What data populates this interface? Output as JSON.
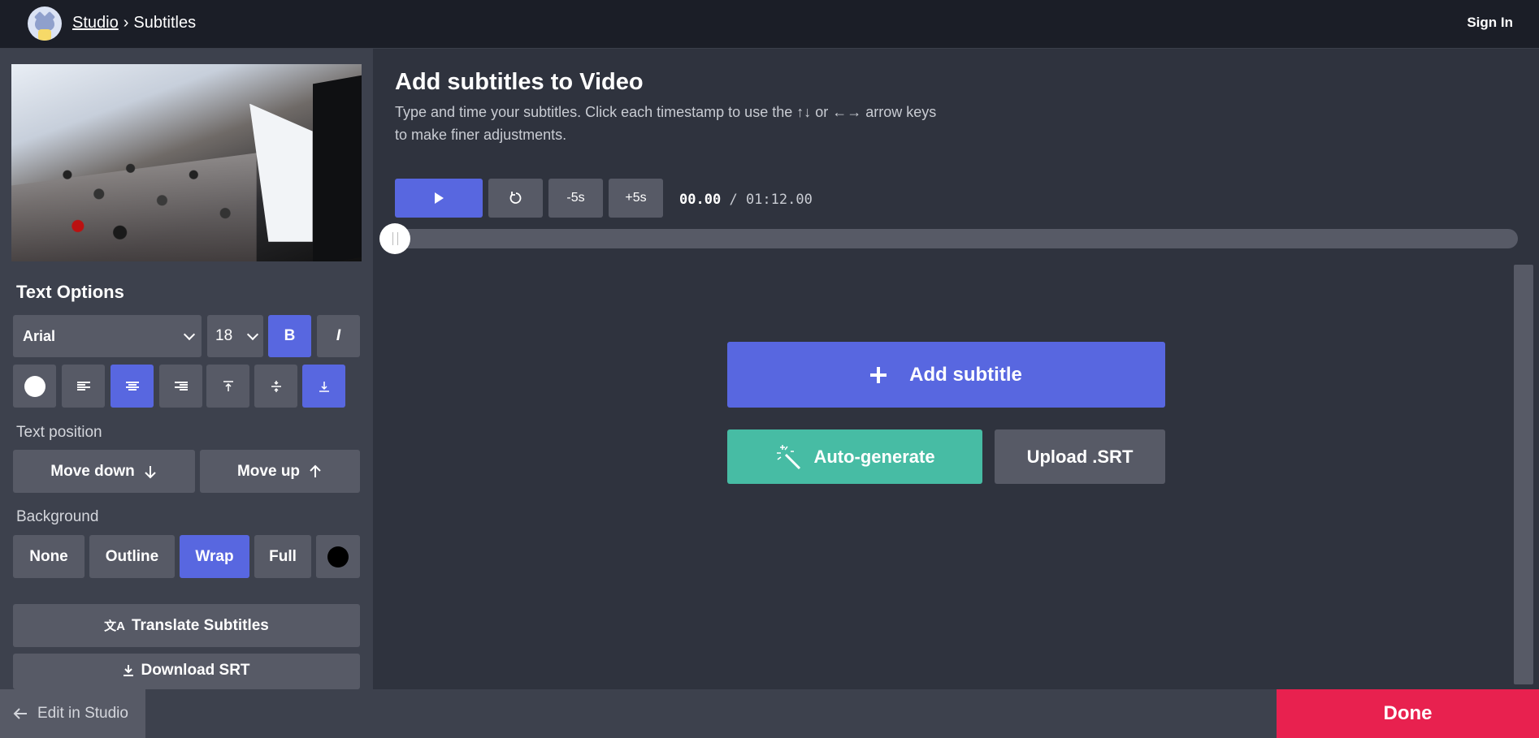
{
  "header": {
    "breadcrumb_studio": "Studio",
    "breadcrumb_sep": "›",
    "breadcrumb_current": "Subtitles",
    "sign_in": "Sign In"
  },
  "sidebar": {
    "text_options_title": "Text Options",
    "font": "Arial",
    "size": "18",
    "bold_label": "B",
    "italic_label": "I",
    "text_position_label": "Text position",
    "move_down": "Move down",
    "move_up": "Move up",
    "background_label": "Background",
    "bg_none": "None",
    "bg_outline": "Outline",
    "bg_wrap": "Wrap",
    "bg_full": "Full",
    "translate": "Translate Subtitles",
    "download": "Download SRT"
  },
  "main": {
    "title": "Add subtitles to Video",
    "description": "Type and time your subtitles. Click each timestamp to use the ↑↓ or ←→ arrow keys to make finer adjustments.",
    "minus5": "-5s",
    "plus5": "+5s",
    "current_time": "00.00",
    "time_sep": "/",
    "total_time": "01:12.00",
    "add_subtitle": "Add subtitle",
    "auto_generate": "Auto-generate",
    "upload_srt": "Upload .SRT"
  },
  "footer": {
    "edit_in_studio": "Edit in Studio",
    "done": "Done"
  },
  "colors": {
    "accent": "#5867e0",
    "done": "#e8214f",
    "auto_generate": "#47bca4"
  }
}
